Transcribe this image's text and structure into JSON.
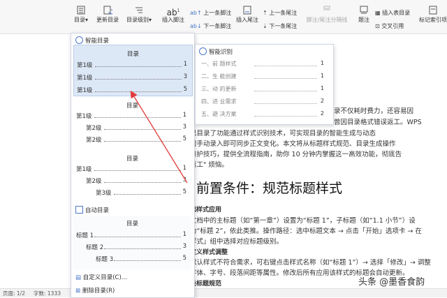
{
  "ribbon": {
    "toc": "目录",
    "update_toc": "更新目录",
    "toc_level": "目录级别",
    "insert_footnote": "插入脚注",
    "prev_footnote": "上一条脚注",
    "next_footnote": "下一条脚注",
    "insert_endnote": "插入尾注",
    "prev_endnote": "上一条尾注",
    "next_endnote": "下一条尾注",
    "footnote_sep": "脚注/尾注分隔线",
    "caption": "题注",
    "insert_table_toc": "插入表目录",
    "cross_ref": "交叉引用",
    "mark_index": "标记索引项",
    "ab_glyph": "ab",
    "ab_superscript": "1"
  },
  "panel": {
    "smart_toc": "智能目录",
    "card_title": "目录",
    "cards": [
      {
        "lines": [
          {
            "t": "第1级",
            "p": "1",
            "indent": 0
          },
          {
            "t": "第1级",
            "p": "3",
            "indent": 0
          },
          {
            "t": "第1级",
            "p": "5",
            "indent": 0
          }
        ]
      },
      {
        "lines": [
          {
            "t": "第1级",
            "p": "1",
            "indent": 0
          },
          {
            "t": "第2级",
            "p": "3",
            "indent": 1
          },
          {
            "t": "第2级",
            "p": "5",
            "indent": 1
          }
        ]
      },
      {
        "lines": [
          {
            "t": "第1级",
            "p": "1",
            "indent": 0
          },
          {
            "t": "第2级",
            "p": "3",
            "indent": 1
          },
          {
            "t": "第3级",
            "p": "5",
            "indent": 2
          }
        ]
      }
    ],
    "auto_toc": "自动目录",
    "auto_card": {
      "lines": [
        {
          "t": "标题 1",
          "p": "1",
          "indent": 0
        },
        {
          "t": "标题 2",
          "p": "3",
          "indent": 1
        },
        {
          "t": "标题 3",
          "p": "5",
          "indent": 2
        }
      ]
    },
    "custom_toc": "自定义目录(C)...",
    "delete_toc": "删除目录(R)"
  },
  "smart": {
    "title": "智能识别",
    "rows": [
      {
        "t": "一、前  题样式",
        "p": "1"
      },
      {
        "t": "二、生  能创建",
        "p": "1"
      },
      {
        "t": "三、动  的更新",
        "p": "1"
      },
      {
        "t": "四、进  业需求",
        "p": "2"
      },
      {
        "t": "五、避  决方案",
        "p": "2"
      }
    ]
  },
  "doc": {
    "l1": "录不仅耗时费力，还容易因",
    "l2": "曾因目录格式错误返工。WPS",
    "l3": "已目录了功能通过样式识别技术，可实现目录的智能生成与动态",
    "l4": "需手动录入即可同步正文变化。本文将从标题样式规范、目录生成操作",
    "l5": "维护技巧，提供全流程指南，助你 10 分钟内掌握这一高效功能，彻底告",
    "l6": "返工\" 烦恼。",
    "heading": "前置条件：规范标题样式",
    "s1": "础样式应用",
    "p1": "文档中的主标题（如“第一章”）设置为“标题 1”，子标题（如“1.1 小节”）设",
    "p2": "为“标题 2”，依此类推。操作路径：选中标题文本 → 点击「开始」选项卡 → 在",
    "p3": "样式」组中选择对应标题级别。",
    "s2": "定义样式调整",
    "p4": "默认样式不符合需求，可右键点击样式名称（如“标题 1”）→ 选择「修改」→ 调整",
    "p5": "字体、字号、段落间距等属性。修改后所有应用该样式的标题会自动更新。",
    "s3": "级标题规范"
  },
  "status": {
    "page": "页面: 1/2",
    "words": "字数: 1333"
  },
  "watermark": "头条 @墨香食韵",
  "colors": {
    "accent": "#4a78c8",
    "arrow": "#e23b3b",
    "selected_card": "#dde8f7"
  }
}
